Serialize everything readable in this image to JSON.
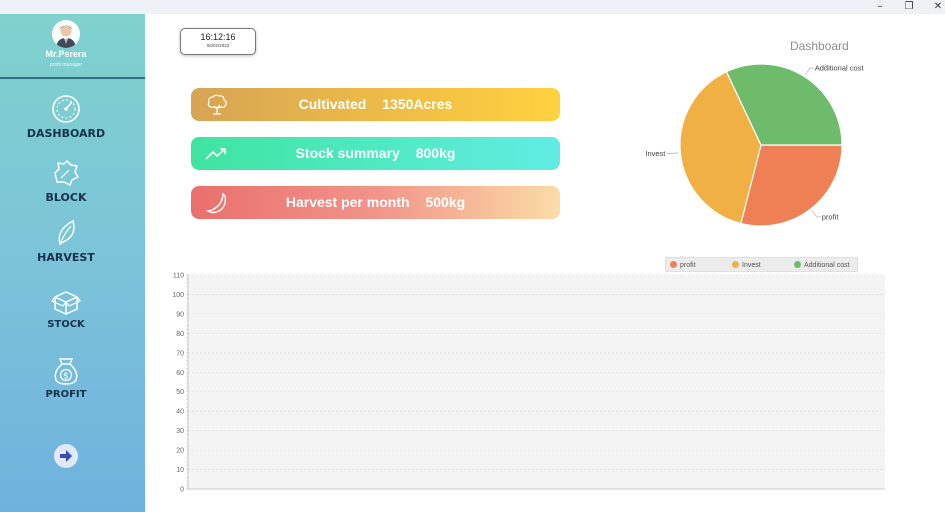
{
  "window": {
    "minimize_glyph": "–",
    "restore_glyph": "❐",
    "close_glyph": "✕"
  },
  "user": {
    "name": "Mr.Perera",
    "role": "profit manager"
  },
  "nav": [
    {
      "label": "DASHBOARD",
      "icon": "gauge-icon"
    },
    {
      "label": "BLOCK",
      "icon": "leaf-block-icon"
    },
    {
      "label": "HARVEST",
      "icon": "leaf-icon"
    },
    {
      "label": "STOCK",
      "icon": "box-icon"
    },
    {
      "label": "PROFIT",
      "icon": "money-bag-icon"
    }
  ],
  "clock": {
    "time": "16:12:16",
    "date": "05/02/2023"
  },
  "cards": [
    {
      "label": "Cultivated",
      "value": "1350Acres",
      "icon": "tree-icon"
    },
    {
      "label": "Stock summary",
      "value": "800kg",
      "icon": "trend-up-icon"
    },
    {
      "label": "Harvest per month",
      "value": "500kg",
      "icon": "banana-icon"
    }
  ],
  "dashboard_title": "Dashboard",
  "colors": {
    "profit": "#ef7f55",
    "invest": "#f0b044",
    "additional_cost": "#6dbb6b",
    "accent": "#2f6f86"
  },
  "chart_data": [
    {
      "type": "pie",
      "title": "",
      "categories": [
        "profit",
        "Invest",
        "Additional cost"
      ],
      "values": [
        29,
        39,
        32
      ],
      "legend_position": "bottom"
    },
    {
      "type": "line",
      "title": "",
      "xlabel": "",
      "ylabel": "",
      "ylim": [
        0,
        110
      ],
      "yticks": [
        0,
        10,
        20,
        30,
        40,
        50,
        60,
        70,
        80,
        90,
        100,
        110
      ],
      "grid": true,
      "series": []
    }
  ]
}
